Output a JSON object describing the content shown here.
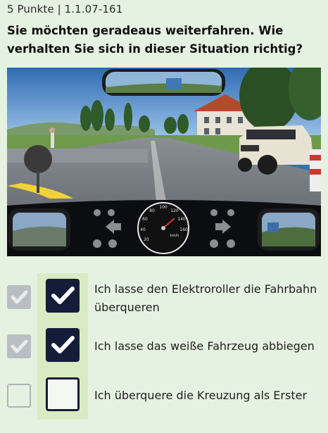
{
  "header": {
    "meta": "5 Punkte | 1.1.07-161",
    "question": "Sie möchten geradeaus weiterfahren. Wie verhalten Sie sich in dieser Situation richtig?"
  },
  "scene": {
    "speedo_unit": "km/h",
    "speedo_ticks": [
      "20",
      "40",
      "60",
      "80",
      "100",
      "120",
      "140",
      "160"
    ]
  },
  "answers": [
    {
      "text": "Ich lasse den Elektroroller die Fahrbahn überqueren",
      "solution_checked": true,
      "user_checked": true
    },
    {
      "text": "Ich lasse das weiße Fahrzeug abbiegen",
      "solution_checked": true,
      "user_checked": true
    },
    {
      "text": "Ich überquere die Kreuzung als Erster",
      "solution_checked": false,
      "user_checked": false
    }
  ],
  "colors": {
    "background": "#e6f2e1",
    "highlight": "#d9ebc2",
    "user_check": "#141c3a",
    "solution_check": "#b9bec4"
  }
}
